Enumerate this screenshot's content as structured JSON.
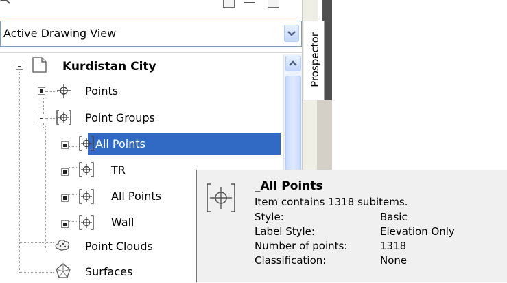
{
  "view_selector": {
    "value": "Active Drawing View"
  },
  "side_tab": {
    "label": "Prospector"
  },
  "tree": {
    "root": {
      "label": "Kurdistan City",
      "icon": "drawing-document-icon"
    },
    "items": [
      {
        "label": "Points",
        "icon": "points-crosshair-icon"
      },
      {
        "label": "Point Groups",
        "icon": "point-groups-icon"
      },
      {
        "label": "_All Points",
        "icon": "point-group-icon",
        "selected": true
      },
      {
        "label": "TR",
        "icon": "point-group-icon"
      },
      {
        "label": "All Points",
        "icon": "point-group-icon"
      },
      {
        "label": "Wall",
        "icon": "point-group-icon"
      },
      {
        "label": "Point Clouds",
        "icon": "point-cloud-icon"
      },
      {
        "label": "Surfaces",
        "icon": "surface-icon"
      }
    ]
  },
  "tooltip": {
    "title": "_All Points",
    "summary": "Item contains 1318 subitems.",
    "rows": [
      {
        "key": "Style:",
        "value": "Basic"
      },
      {
        "key": "Label Style:",
        "value": "Elevation Only"
      },
      {
        "key": "Number of points:",
        "value": "1318"
      },
      {
        "key": "Classification:",
        "value": "None"
      }
    ]
  }
}
